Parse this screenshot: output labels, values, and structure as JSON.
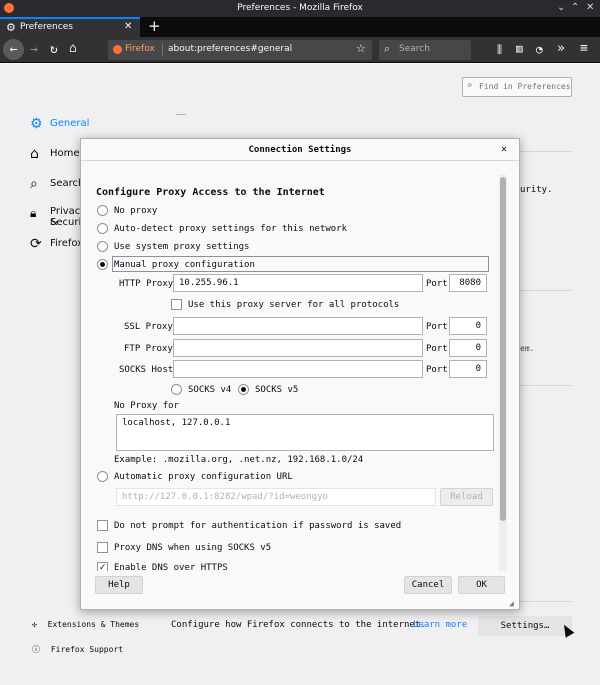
{
  "window": {
    "title": "Preferences - Mozilla Firefox"
  },
  "tab": {
    "label": "Preferences",
    "new_tab": "+"
  },
  "navbar": {
    "identity": "Firefox",
    "url": "about:preferences#general",
    "search_placeholder": "Search"
  },
  "prefs": {
    "find_placeholder": "Find in Preferences",
    "sidebar": [
      "General",
      "Home",
      "Search",
      "Privacy &",
      "Security",
      "Firefox"
    ],
    "right_fragments": [
      "urity.",
      "em."
    ],
    "bottom_links": [
      "Extensions & Themes",
      "Firefox Support"
    ],
    "network_text": "Configure how Firefox connects to the internet.",
    "learn_more": "Learn more",
    "settings_button": "Settings…"
  },
  "dialog": {
    "title": "Connection Settings",
    "heading": "Configure Proxy Access to the Internet",
    "options": {
      "no_proxy": "No proxy",
      "auto_detect": "Auto-detect proxy settings for this network",
      "system": "Use system proxy settings",
      "manual": "Manual proxy configuration",
      "auto_url": "Automatic proxy configuration URL"
    },
    "http_proxy_label": "HTTP Proxy",
    "http_proxy_value": "10.255.96.1",
    "port_label": "Port",
    "http_port": "8080",
    "use_for_all": "Use this proxy server for all protocols",
    "ssl_label": "SSL Proxy",
    "ssl_port": "0",
    "ftp_label": "FTP Proxy",
    "ftp_port": "0",
    "socks_label": "SOCKS Host",
    "socks_port": "0",
    "socks_v4": "SOCKS v4",
    "socks_v5": "SOCKS v5",
    "no_proxy_for": "No Proxy for",
    "no_proxy_value": "localhost, 127.0.0.1",
    "example": "Example: .mozilla.org, .net.nz, 192.168.1.0/24",
    "pac_placeholder": "http://127.0.0.1:8282/wpad/?id=weongyo",
    "reload": "Reload",
    "no_prompt": "Do not prompt for authentication if password is saved",
    "proxy_dns": "Proxy DNS when using SOCKS v5",
    "dns_https": "Enable DNS over HTTPS",
    "help": "Help",
    "cancel": "Cancel",
    "ok": "OK"
  }
}
